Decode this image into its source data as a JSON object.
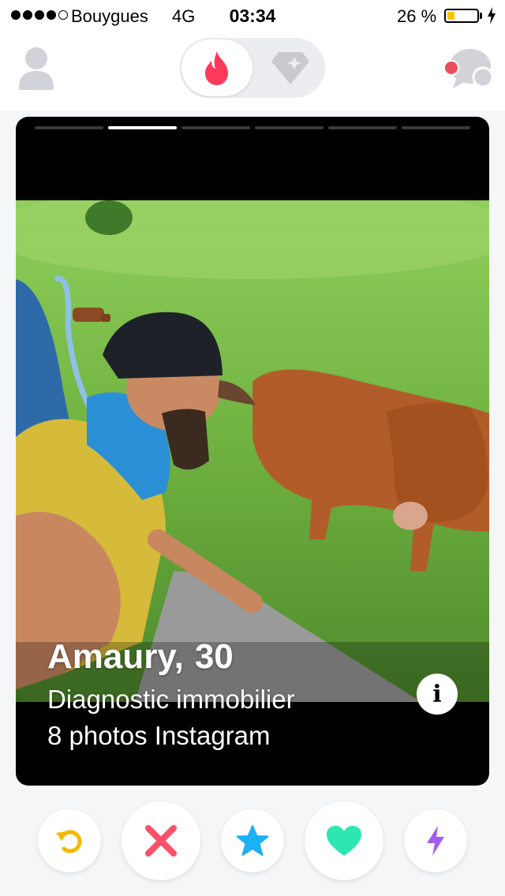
{
  "status_bar": {
    "carrier": "Bouygues",
    "network": "4G",
    "time": "03:34",
    "battery_percent": "26 %",
    "battery_level": 0.26,
    "signal_bars": 4,
    "icons": [
      "signal-dots-icon",
      "battery-icon",
      "charging-bolt-icon"
    ]
  },
  "topnav": {
    "icons": [
      "profile-icon",
      "flame-icon",
      "diamond-icon",
      "chat-icon"
    ],
    "active_tab": "flame",
    "brand_color": "#fd3a5a",
    "chat_notification_color": "#ea4d5c"
  },
  "card": {
    "photo_count": 6,
    "active_photo": 1,
    "name": "Amaury,",
    "age": "30",
    "job": "Diagnostic immobilier",
    "instagram": "8 photos Instagram",
    "info_icon": "i"
  },
  "actions": {
    "items": [
      {
        "name": "rewind",
        "icon": "rewind-icon",
        "color": "#f5b800"
      },
      {
        "name": "nope",
        "icon": "x-icon",
        "color": "#fd5068"
      },
      {
        "name": "super-like",
        "icon": "star-icon",
        "color": "#1cb0f6"
      },
      {
        "name": "like",
        "icon": "heart-icon",
        "color": "#2de6b0"
      },
      {
        "name": "boost",
        "icon": "bolt-icon",
        "color": "#a15df1"
      }
    ]
  }
}
